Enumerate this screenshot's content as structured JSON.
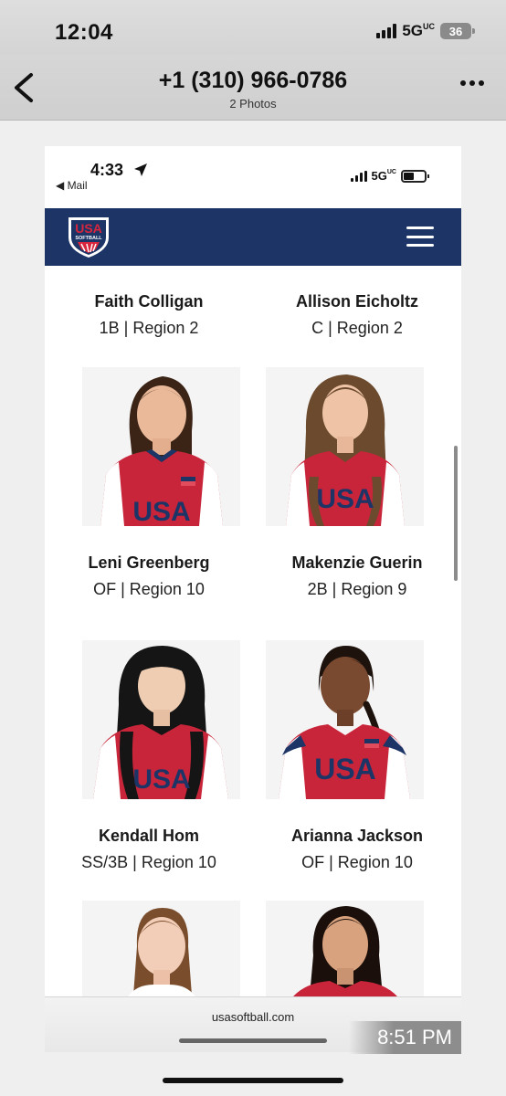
{
  "status_bar": {
    "time": "12:04",
    "network": "5G",
    "network_suffix": "UC",
    "battery": "36"
  },
  "header": {
    "title": "+1 (310) 966-0786",
    "subtitle": "2 Photos"
  },
  "inner_status": {
    "time": "4:33",
    "back_app": "◀ Mail",
    "network": "5G",
    "network_suffix": "UC"
  },
  "site": {
    "logo_top": "USA",
    "logo_bottom": "SOFTBALL"
  },
  "players": [
    {
      "name": "Faith Colligan",
      "position": "1B | Region 2"
    },
    {
      "name": "Allison Eicholtz",
      "position": "C | Region 2"
    },
    {
      "name": "Leni Greenberg",
      "position": "OF | Region 10"
    },
    {
      "name": "Makenzie Guerin",
      "position": "2B | Region 9"
    },
    {
      "name": "Kendall Hom",
      "position": "SS/3B | Region 10"
    },
    {
      "name": "Arianna Jackson",
      "position": "OF | Region 10"
    }
  ],
  "jersey_text": "USA",
  "url_bar": {
    "url": "usasoftball.com"
  },
  "timestamp": "8:51 PM",
  "colors": {
    "navy": "#1c3466",
    "jersey_red": "#c9253a"
  }
}
